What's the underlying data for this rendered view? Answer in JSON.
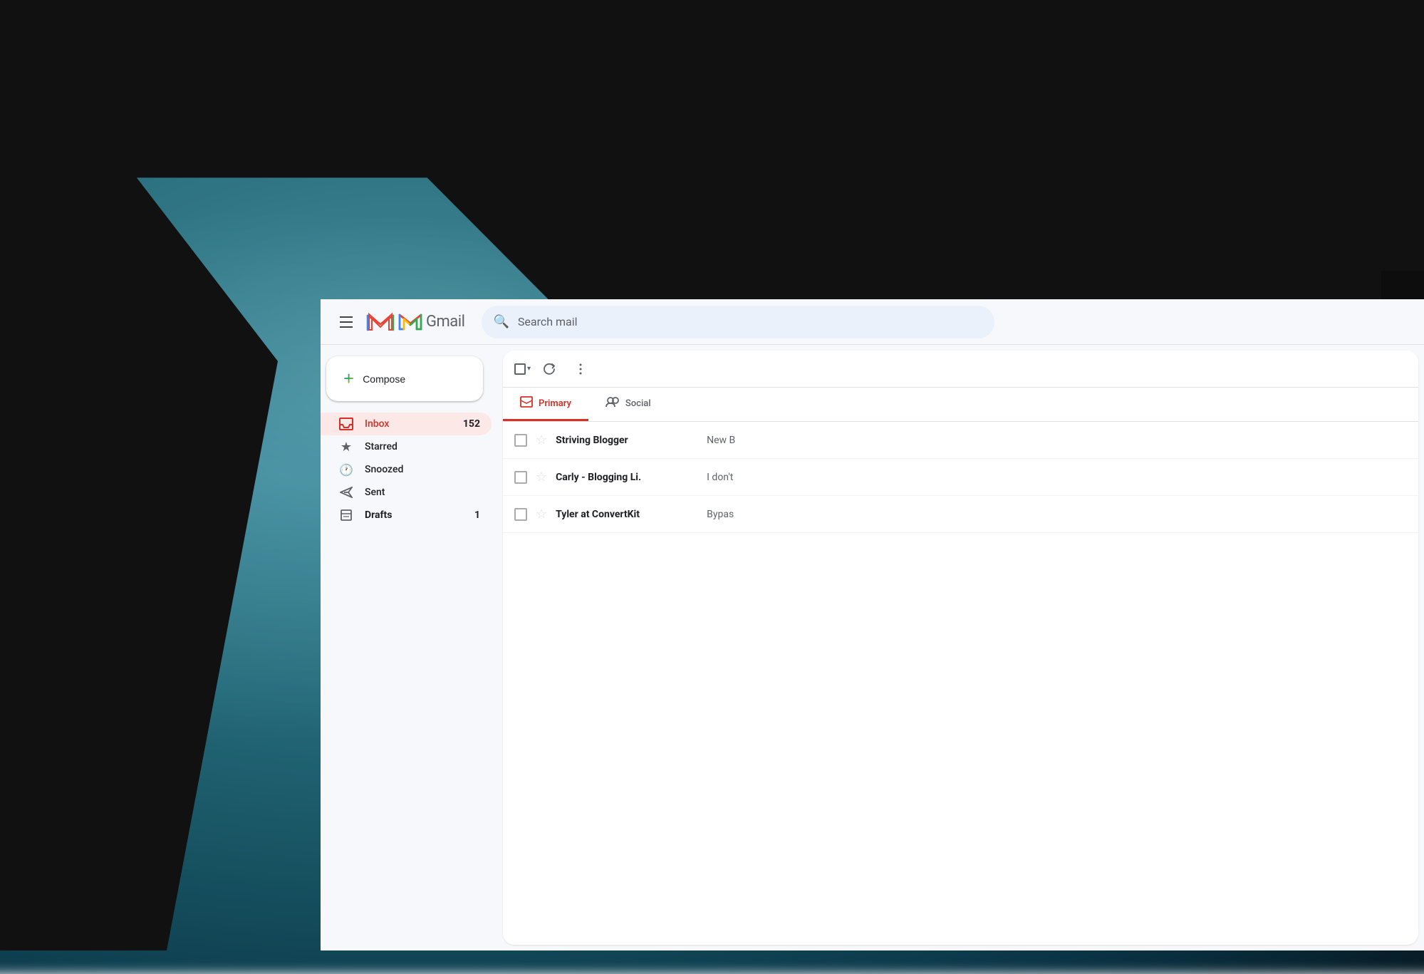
{
  "app": {
    "title": "Gmail",
    "logo_text": "Gmail"
  },
  "header": {
    "menu_label": "Main menu",
    "search_placeholder": "Search mail"
  },
  "sidebar": {
    "compose_label": "Compose",
    "nav_items": [
      {
        "id": "inbox",
        "label": "Inbox",
        "count": "152",
        "active": true
      },
      {
        "id": "starred",
        "label": "Starred",
        "count": "",
        "active": false
      },
      {
        "id": "snoozed",
        "label": "Snoozed",
        "count": "",
        "active": false
      },
      {
        "id": "sent",
        "label": "Sent",
        "count": "",
        "active": false
      },
      {
        "id": "drafts",
        "label": "Drafts",
        "count": "1",
        "active": false
      }
    ]
  },
  "toolbar": {
    "select_label": "Select",
    "refresh_label": "Refresh",
    "more_label": "More"
  },
  "tabs": [
    {
      "id": "primary",
      "label": "Primary",
      "active": true
    },
    {
      "id": "social",
      "label": "Social",
      "active": false
    }
  ],
  "emails": [
    {
      "sender": "Striving Blogger",
      "preview": "New B",
      "read": false
    },
    {
      "sender": "Carly - Blogging Li.",
      "preview": "I don't",
      "read": false
    },
    {
      "sender": "Tyler at ConvertKit",
      "preview": "Bypas",
      "read": false
    }
  ],
  "colors": {
    "accent_red": "#d93025",
    "gmail_blue": "#4285f4",
    "gmail_green": "#34a853",
    "gmail_yellow": "#fbbc05",
    "gmail_red": "#ea4335",
    "sidebar_active_bg": "#fce8e6",
    "surface": "#f6f8fc",
    "primary_text": "#202124",
    "secondary_text": "#5f6368"
  }
}
